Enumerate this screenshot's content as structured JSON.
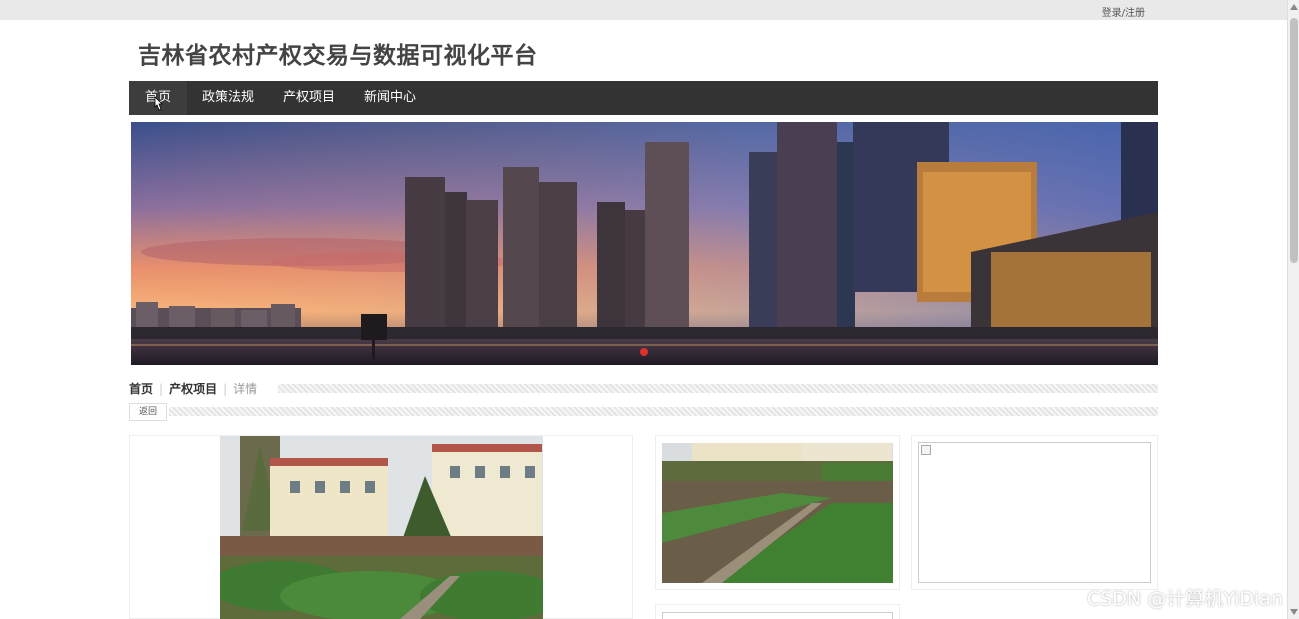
{
  "topbar": {
    "login_label": "登录/注册"
  },
  "site": {
    "title": "吉林省农村产权交易与数据可视化平台"
  },
  "nav": {
    "items": [
      {
        "label": "首页"
      },
      {
        "label": "政策法规"
      },
      {
        "label": "产权项目"
      },
      {
        "label": "新闻中心"
      }
    ],
    "active_index": 0
  },
  "breadcrumb": {
    "home": "首页",
    "section": "产权项目",
    "current": "详情"
  },
  "back_button": {
    "label": "返回"
  },
  "watermark": {
    "text": "CSDN @计算机YiDian"
  },
  "colors": {
    "nav_bg": "#333333",
    "topbar_bg": "#e9e9e9"
  }
}
